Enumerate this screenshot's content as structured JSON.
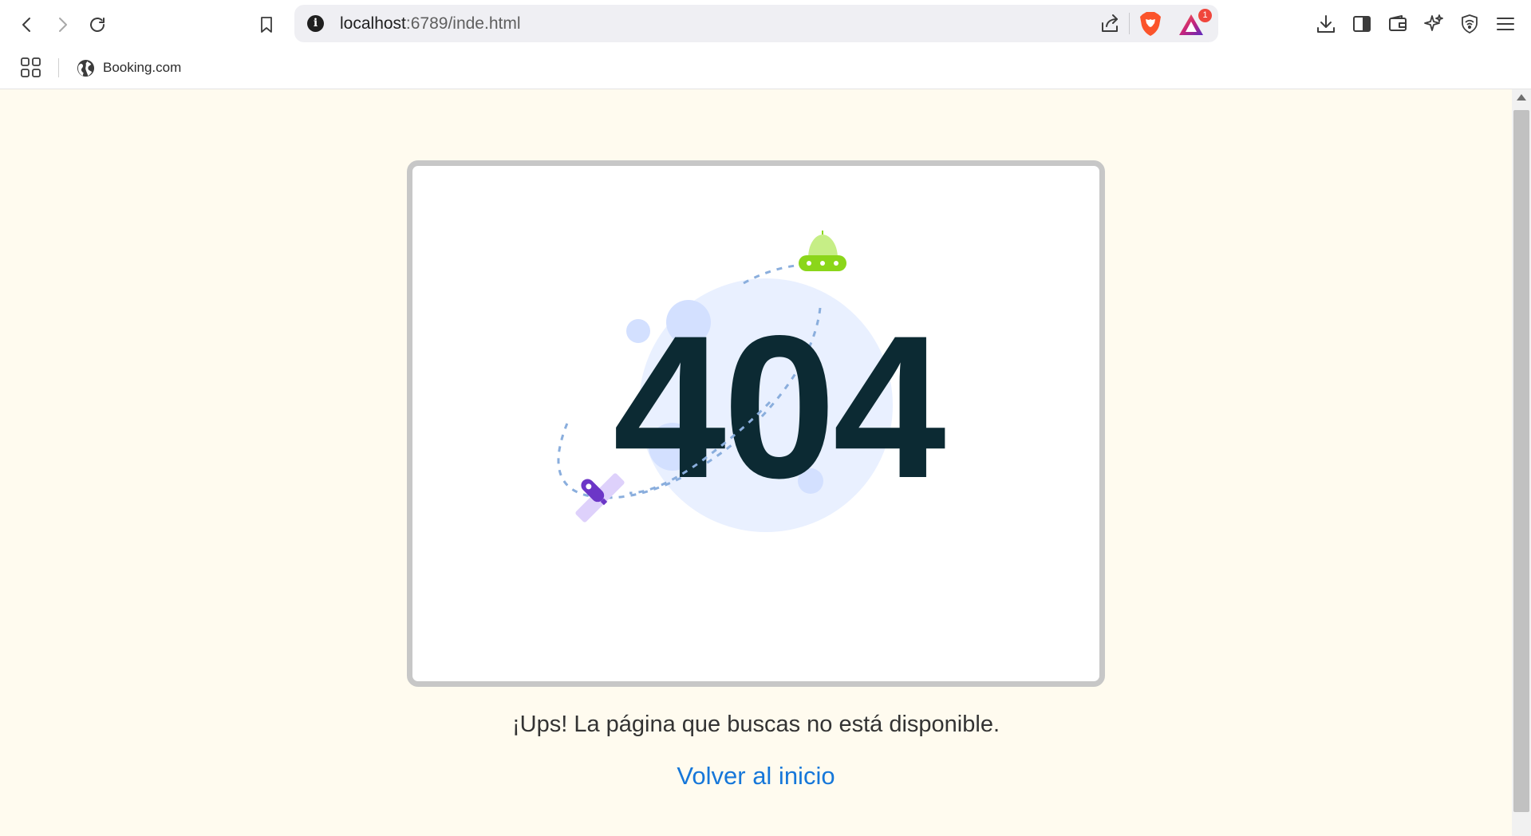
{
  "browser": {
    "url_host": "localhost",
    "url_path": ":6789/inde.html",
    "rewards_badge": "1",
    "accent_colors": {
      "brave_orange": "#fb542b",
      "badge_red": "#f0463c"
    }
  },
  "bookmarks": [
    {
      "label": "Booking.com",
      "icon": "globe-icon"
    }
  ],
  "page": {
    "background": "#fffbef",
    "illustration": {
      "digits": "404",
      "digit_color": "#0c2a33",
      "planet_color": "#e9f0ff",
      "ufo_color": "#8bd61a",
      "rocket_color": "#6c36c7"
    },
    "message": "¡Ups! La página que buscas no está disponible.",
    "home_link": "Volver al inicio",
    "link_color": "#1677d9"
  }
}
